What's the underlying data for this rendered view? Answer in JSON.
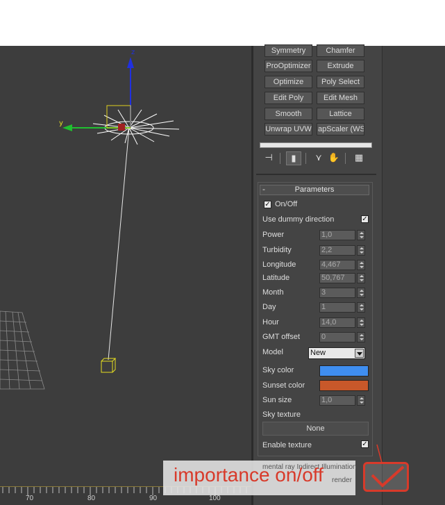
{
  "modifier_buttons": [
    {
      "label": "Symmetry"
    },
    {
      "label": "Chamfer"
    },
    {
      "label": "ProOptimizer"
    },
    {
      "label": "Extrude"
    },
    {
      "label": "Optimize"
    },
    {
      "label": "Poly Select"
    },
    {
      "label": "Edit Poly"
    },
    {
      "label": "Edit Mesh"
    },
    {
      "label": "Smooth"
    },
    {
      "label": "Lattice"
    },
    {
      "label": "Unwrap UVW"
    },
    {
      "label": "apScaler (WSM"
    }
  ],
  "viewport": {
    "axis_z": "z",
    "axis_y": "y",
    "ruler_labels": [
      "70",
      "80",
      "90",
      "100"
    ]
  },
  "parameters": {
    "title": "Parameters",
    "collapse": "-",
    "on_off_label": "On/Off",
    "on_off_checked": true,
    "dummy_label": "Use dummy direction",
    "dummy_checked": true,
    "fields": [
      {
        "label": "Power",
        "value": "1,0"
      },
      {
        "label": "Turbidity",
        "value": "2,2"
      },
      {
        "label": "Longitude",
        "value": "4,467"
      },
      {
        "label": "Latitude",
        "value": "50,767"
      },
      {
        "label": "Month",
        "value": "3"
      },
      {
        "label": "Day",
        "value": "1"
      },
      {
        "label": "Hour",
        "value": "14,0"
      },
      {
        "label": "GMT offset",
        "value": "0"
      }
    ],
    "model_label": "Model",
    "model_value": "New",
    "sky_color_label": "Sky color",
    "sky_color": "#3f8ef0",
    "sunset_color_label": "Sunset color",
    "sunset_color": "#c8582a",
    "sun_size_label": "Sun size",
    "sun_size_value": "1,0",
    "sky_texture_label": "Sky texture",
    "sky_texture_button": "None",
    "enable_texture_label": "Enable texture",
    "enable_texture_checked": true,
    "overlay_line1": "mental ray Indirect Illumination",
    "overlay_line2": "render"
  },
  "annotation": {
    "text": "importance on/off",
    "color": "#d83a2a"
  }
}
